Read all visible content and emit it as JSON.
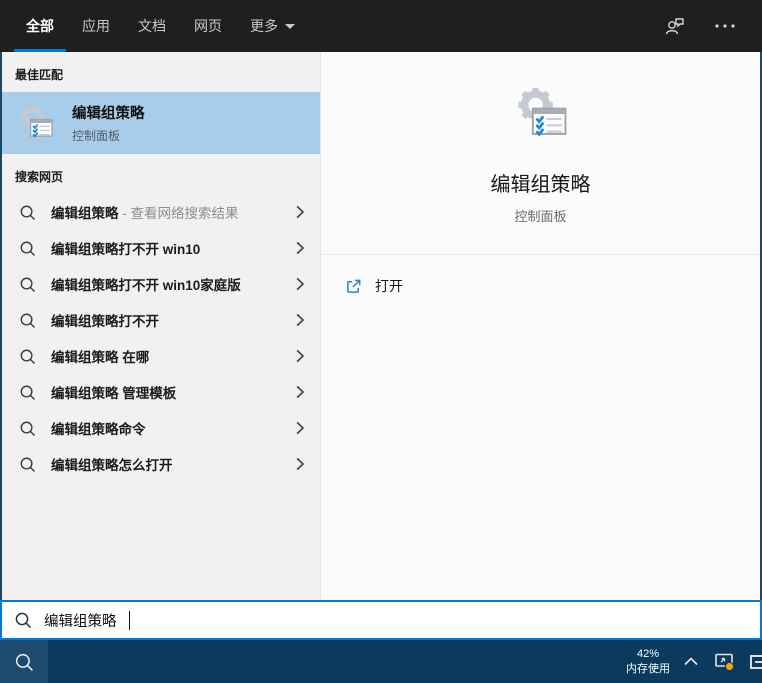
{
  "colors": {
    "accent": "#0078d7",
    "topbar_background": "#1f1f1f",
    "best_match_highlight": "#a9cce8",
    "taskbar_background": "#0b3a5f",
    "tray_badge_orange": "#f0a30a"
  },
  "topbar": {
    "tabs": [
      {
        "label": "全部",
        "active": true
      },
      {
        "label": "应用",
        "active": false
      },
      {
        "label": "文档",
        "active": false
      },
      {
        "label": "网页",
        "active": false
      },
      {
        "label": "更多",
        "active": false,
        "has_dropdown": true
      }
    ],
    "icons": {
      "feedback": "person-with-chat-bubble",
      "more_options": "ellipsis"
    }
  },
  "left_panel": {
    "best_match_header": "最佳匹配",
    "best_match": {
      "title": "编辑组策略",
      "subtitle": "控制面板",
      "icon": "group-policy-gear-checklist"
    },
    "web_search_header": "搜索网页",
    "suggestions": [
      {
        "text": "编辑组策略",
        "suffix": " - 查看网络搜索结果"
      },
      {
        "text": "编辑组策略打不开 win10",
        "suffix": ""
      },
      {
        "text": "编辑组策略打不开 win10家庭版",
        "suffix": ""
      },
      {
        "text": "编辑组策略打不开",
        "suffix": ""
      },
      {
        "text": "编辑组策略 在哪",
        "suffix": ""
      },
      {
        "text": "编辑组策略 管理模板",
        "suffix": ""
      },
      {
        "text": "编辑组策略命令",
        "suffix": ""
      },
      {
        "text": "编辑组策略怎么打开",
        "suffix": ""
      }
    ]
  },
  "preview": {
    "title": "编辑组策略",
    "subtitle": "控制面板",
    "icon": "group-policy-gear-checklist",
    "actions": [
      {
        "label": "打开",
        "icon": "open-in-new"
      }
    ]
  },
  "searchbox": {
    "value": "编辑组策略"
  },
  "taskbar": {
    "memory_percent": "42%",
    "memory_label": "内存使用",
    "icons": {
      "search": "magnifier",
      "hidden_icons": "chevron-up",
      "tray1": "screen-with-orange-badge",
      "tray2": "partial-monitor"
    }
  }
}
